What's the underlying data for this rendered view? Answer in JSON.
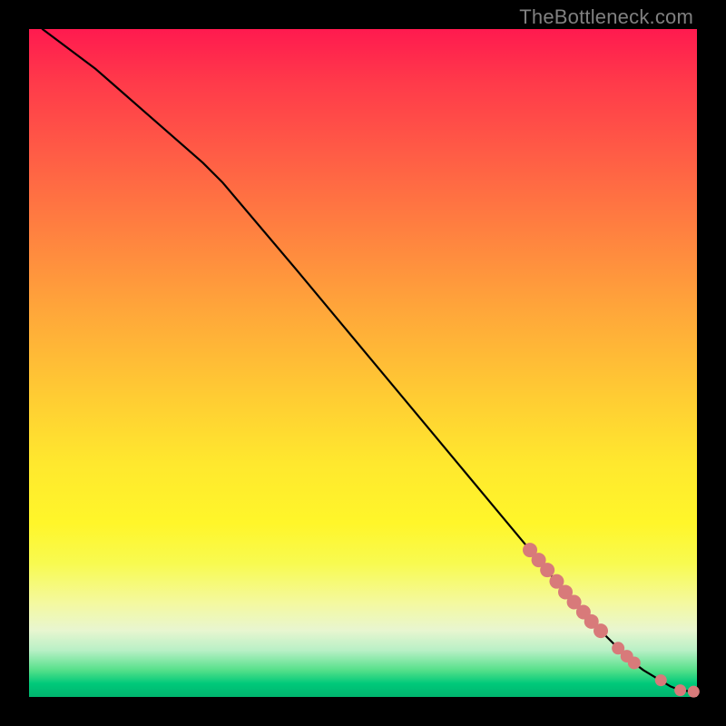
{
  "watermark": "TheBottleneck.com",
  "chart_data": {
    "type": "line",
    "title": "",
    "xlabel": "",
    "ylabel": "",
    "xlim": [
      0,
      100
    ],
    "ylim": [
      0,
      100
    ],
    "grid": false,
    "series": [
      {
        "name": "curve",
        "stroke": "#000000",
        "x": [
          2,
          10,
          18,
          26,
          29,
          40,
          50,
          60,
          70,
          75,
          80,
          85,
          88,
          90,
          92,
          94,
          95,
          96,
          97.5,
          99.5
        ],
        "y": [
          100,
          94,
          87,
          80,
          77,
          64,
          52,
          40,
          28,
          22,
          16,
          10.5,
          7.5,
          5.5,
          4,
          2.8,
          2.2,
          1.6,
          1,
          0.8
        ]
      }
    ],
    "markers": {
      "color": "#d87a7a",
      "radius_large": 8,
      "radius_small": 6.5,
      "points": [
        {
          "x": 75.0,
          "y": 22.0,
          "r": 8
        },
        {
          "x": 76.3,
          "y": 20.5,
          "r": 8
        },
        {
          "x": 77.6,
          "y": 19.0,
          "r": 8
        },
        {
          "x": 79.0,
          "y": 17.3,
          "r": 8
        },
        {
          "x": 80.3,
          "y": 15.7,
          "r": 8
        },
        {
          "x": 81.6,
          "y": 14.2,
          "r": 8
        },
        {
          "x": 83.0,
          "y": 12.7,
          "r": 8
        },
        {
          "x": 84.2,
          "y": 11.3,
          "r": 8
        },
        {
          "x": 85.6,
          "y": 9.9,
          "r": 8
        },
        {
          "x": 88.2,
          "y": 7.3,
          "r": 7
        },
        {
          "x": 89.5,
          "y": 6.1,
          "r": 7
        },
        {
          "x": 90.6,
          "y": 5.1,
          "r": 7
        },
        {
          "x": 94.6,
          "y": 2.5,
          "r": 6.5
        },
        {
          "x": 97.5,
          "y": 1.0,
          "r": 6.5
        },
        {
          "x": 99.5,
          "y": 0.8,
          "r": 6.5
        }
      ]
    }
  }
}
